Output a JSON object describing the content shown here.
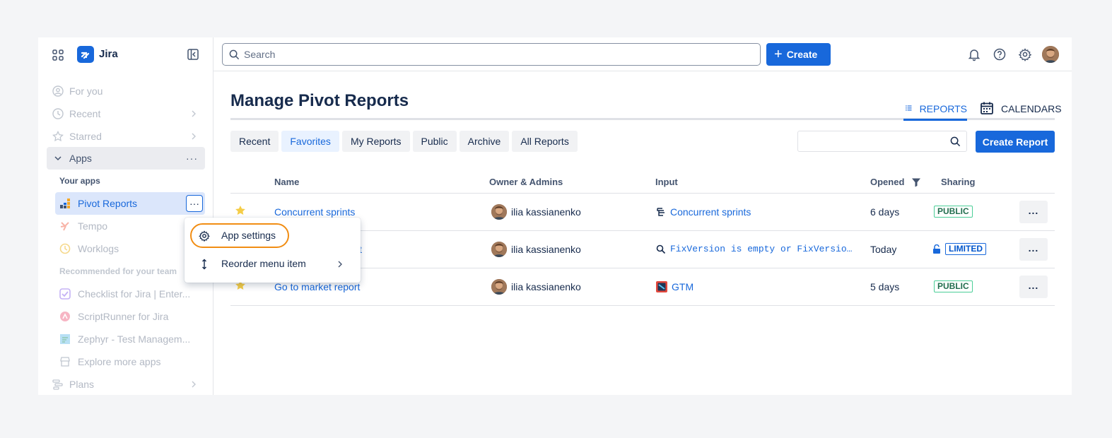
{
  "sidebar": {
    "brand": "Jira",
    "items": [
      {
        "label": "For you"
      },
      {
        "label": "Recent"
      },
      {
        "label": "Starred"
      },
      {
        "label": "Apps"
      },
      {
        "label": "Pivot Reports"
      },
      {
        "label": "Tempo"
      },
      {
        "label": "Worklogs"
      },
      {
        "label": "Checklist for Jira | Enter..."
      },
      {
        "label": "ScriptRunner for Jira"
      },
      {
        "label": "Zephyr - Test Managem..."
      },
      {
        "label": "Explore more apps"
      },
      {
        "label": "Plans"
      }
    ],
    "section_your_apps": "Your apps",
    "section_recommended": "Recommended for your team"
  },
  "context_menu": {
    "items": [
      {
        "label": "App settings",
        "icon": "gear-icon"
      },
      {
        "label": "Reorder menu item",
        "icon": "reorder-icon"
      }
    ],
    "highlight_color": "#f18d13"
  },
  "topbar": {
    "search_placeholder": "Search",
    "create_label": "Create"
  },
  "main": {
    "title": "Manage Pivot Reports",
    "view_tabs": [
      {
        "label": "REPORTS",
        "active": true
      },
      {
        "label": "CALENDARS",
        "active": false
      }
    ],
    "filter_tabs": [
      {
        "label": "Recent"
      },
      {
        "label": "Favorites",
        "active": true
      },
      {
        "label": "My Reports"
      },
      {
        "label": "Public"
      },
      {
        "label": "Archive"
      },
      {
        "label": "All Reports"
      }
    ],
    "create_report_label": "Create Report",
    "table": {
      "headers": [
        "Name",
        "Owner & Admins",
        "Input",
        "Opened",
        "Sharing"
      ],
      "rows": [
        {
          "name": "Concurrent sprints",
          "owner": "ilia kassianenko",
          "input": "Concurrent sprints",
          "opened": "6 days",
          "sharing": "PUBLIC"
        },
        {
          "name": "t",
          "owner": "ilia kassianenko",
          "input": "FixVersion is empty or FixVersion…",
          "opened": "Today",
          "sharing": "LIMITED"
        },
        {
          "name": "Go to market report",
          "owner": "ilia kassianenko",
          "input": "GTM",
          "opened": "5 days",
          "sharing": "PUBLIC"
        }
      ]
    }
  },
  "colors": {
    "accent": "#1868db",
    "star": "#f5cd47"
  }
}
